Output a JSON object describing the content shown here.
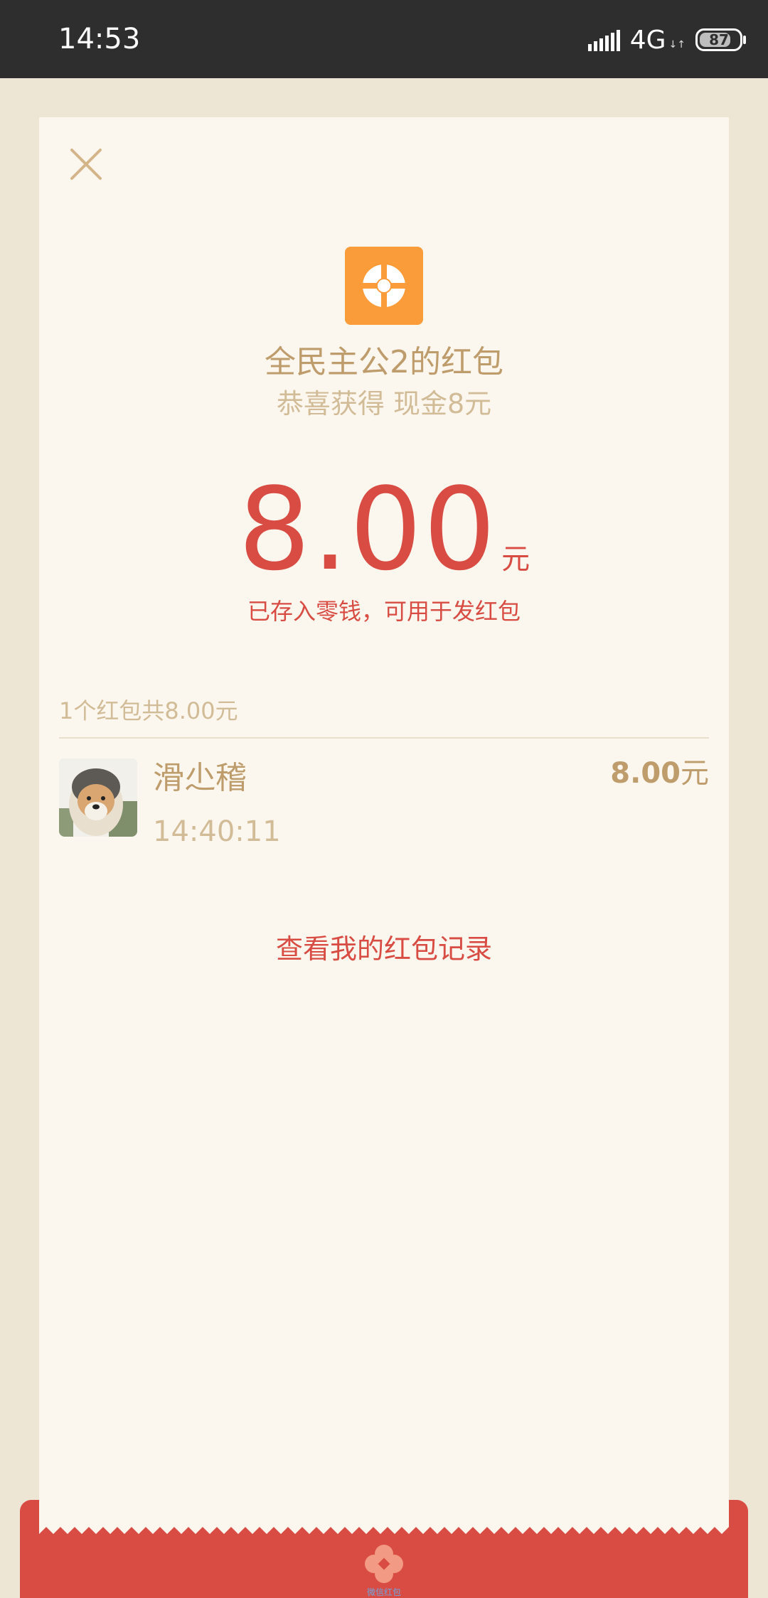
{
  "status_bar": {
    "time": "14:53",
    "network": "4G",
    "battery": "87"
  },
  "envelope": {
    "sender_title": "全民主公2的红包",
    "greeting": "恭喜获得 现金8元",
    "amount": "8.00",
    "amount_unit": "元",
    "saved_note": "已存入零钱，可用于发红包"
  },
  "receivers": {
    "summary": "1个红包共8.00元",
    "items": [
      {
        "name": "滑尐稽",
        "time": "14:40:11",
        "amount": "8.00",
        "unit": "元"
      }
    ]
  },
  "records_link": "查看我的红包记录",
  "bottom_caption": "微信红包",
  "colors": {
    "status_bar": "#2E2E2E",
    "page_background": "#EDE6D4",
    "card_background": "#FBF7EE",
    "accent_red": "#D84C43",
    "gold_text": "#BE9C6C",
    "light_gold_text": "#D2BC97",
    "logo_orange": "#FB9C3A"
  },
  "icons": [
    "close-icon",
    "game-logo-icon",
    "avatar",
    "red-packet-logo-icon",
    "signal-icon",
    "battery-icon"
  ]
}
